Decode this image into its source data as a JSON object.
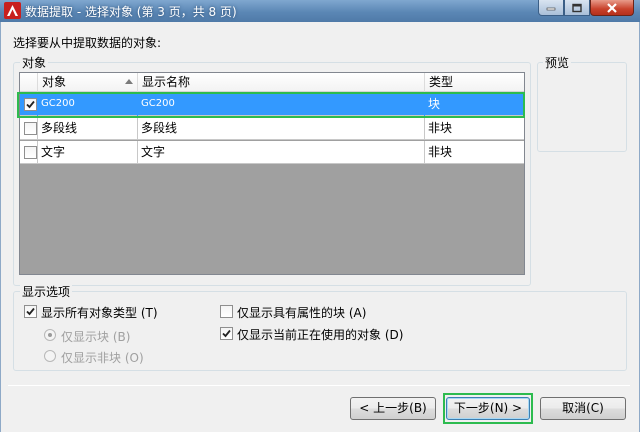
{
  "window": {
    "title": "数据提取 - 选择对象 (第 3 页，共 8 页)"
  },
  "prompt": "选择要从中提取数据的对象:",
  "objects_group": {
    "label": "对象",
    "columns": [
      "对象",
      "显示名称",
      "类型"
    ],
    "rows": [
      {
        "checked": true,
        "object": "GC200",
        "display": "GC200",
        "type": "块",
        "selected": true
      },
      {
        "checked": false,
        "object": "多段线",
        "display": "多段线",
        "type": "非块",
        "selected": false
      },
      {
        "checked": false,
        "object": "文字",
        "display": "文字",
        "type": "非块",
        "selected": false
      }
    ]
  },
  "preview_group": {
    "label": "预览"
  },
  "display_options": {
    "label": "显示选项",
    "show_all_types": {
      "label": "显示所有对象类型 (T)",
      "checked": true
    },
    "only_blocks": {
      "label": "仅显示块 (B)",
      "selected": true,
      "enabled": false
    },
    "only_non_blocks": {
      "label": "仅显示非块 (O)",
      "selected": false,
      "enabled": false
    },
    "only_attr_blocks": {
      "label": "仅显示具有属性的块 (A)",
      "checked": false
    },
    "only_in_use": {
      "label": "仅显示当前正在使用的对象 (D)",
      "checked": true
    }
  },
  "buttons": {
    "prev": "< 上一步(B)",
    "next": "下一步(N) >",
    "cancel": "取消(C)"
  },
  "colors": {
    "selection": "#3399ff",
    "highlight": "#2dbb4f",
    "titlebar": "#5b87b5"
  }
}
